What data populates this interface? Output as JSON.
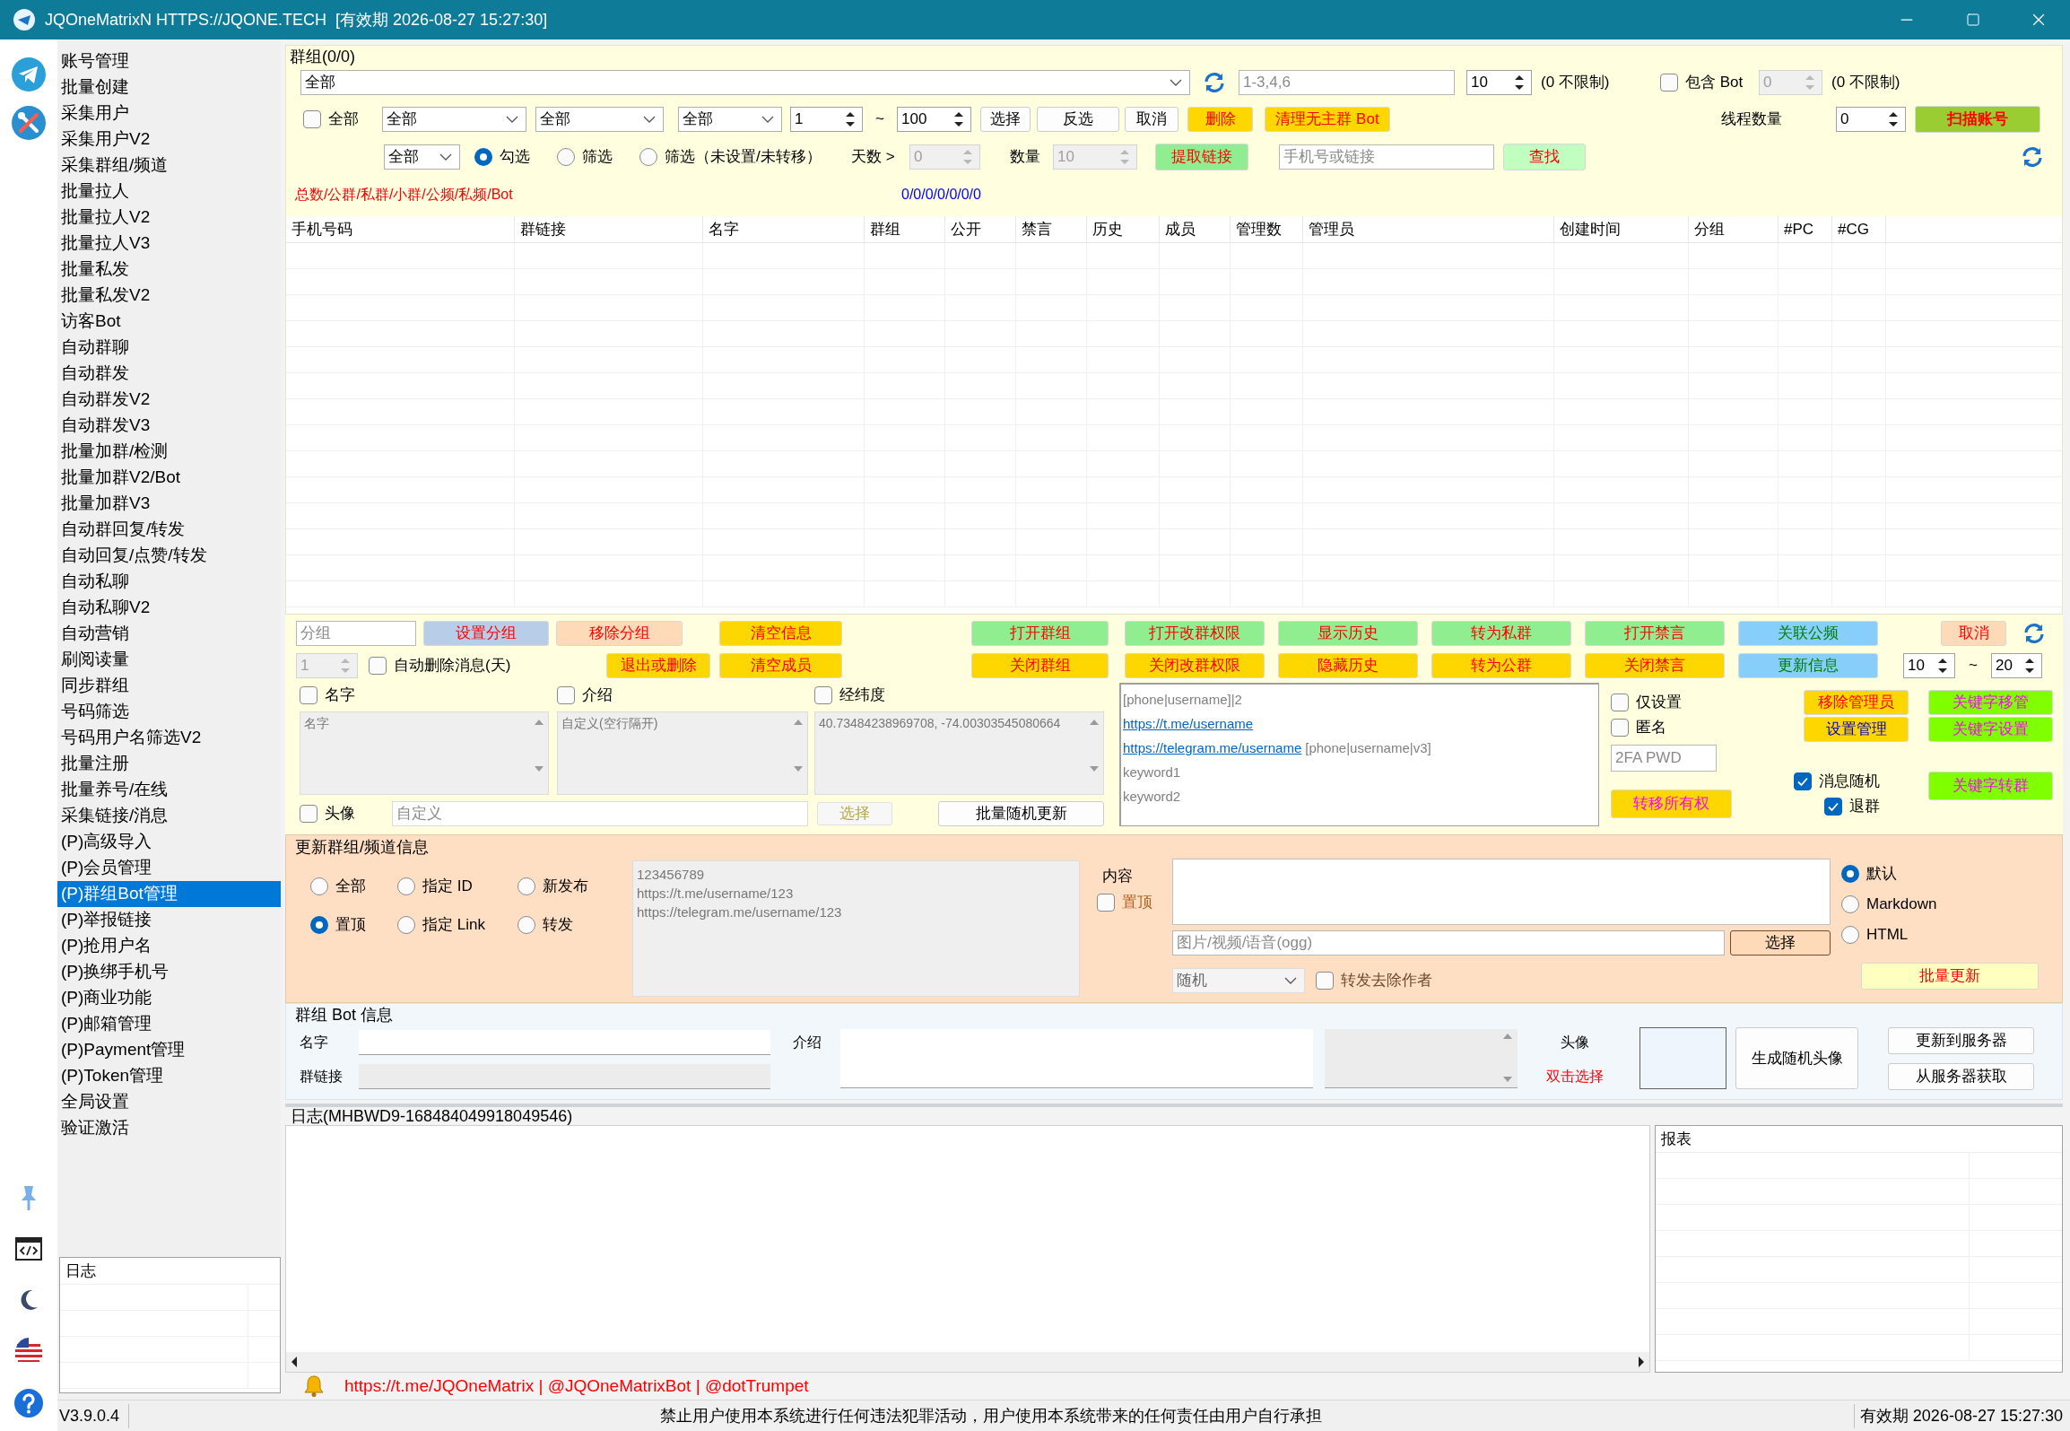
{
  "window": {
    "title": "JQOneMatrixN HTTPS://JQONE.TECH  [有效期 2026-08-27 15:27:30]"
  },
  "sidebar": {
    "items": [
      {
        "label": "账号管理",
        "selected": false
      },
      {
        "label": "批量创建",
        "selected": false
      },
      {
        "label": "采集用户",
        "selected": false
      },
      {
        "label": "采集用户V2",
        "selected": false
      },
      {
        "label": "采集群组/频道",
        "selected": false
      },
      {
        "label": "批量拉人",
        "selected": false
      },
      {
        "label": "批量拉人V2",
        "selected": false
      },
      {
        "label": "批量拉人V3",
        "selected": false
      },
      {
        "label": "批量私发",
        "selected": false
      },
      {
        "label": "批量私发V2",
        "selected": false
      },
      {
        "label": "访客Bot",
        "selected": false
      },
      {
        "label": "自动群聊",
        "selected": false
      },
      {
        "label": "自动群发",
        "selected": false
      },
      {
        "label": "自动群发V2",
        "selected": false
      },
      {
        "label": "自动群发V3",
        "selected": false
      },
      {
        "label": "批量加群/检测",
        "selected": false
      },
      {
        "label": "批量加群V2/Bot",
        "selected": false
      },
      {
        "label": "批量加群V3",
        "selected": false
      },
      {
        "label": "自动群回复/转发",
        "selected": false
      },
      {
        "label": "自动回复/点赞/转发",
        "selected": false
      },
      {
        "label": "自动私聊",
        "selected": false
      },
      {
        "label": "自动私聊V2",
        "selected": false
      },
      {
        "label": "自动营销",
        "selected": false
      },
      {
        "label": "刷阅读量",
        "selected": false
      },
      {
        "label": "同步群组",
        "selected": false
      },
      {
        "label": "号码筛选",
        "selected": false
      },
      {
        "label": "号码用户名筛选V2",
        "selected": false
      },
      {
        "label": "批量注册",
        "selected": false
      },
      {
        "label": "批量养号/在线",
        "selected": false
      },
      {
        "label": "采集链接/消息",
        "selected": false
      },
      {
        "label": "(P)高级导入",
        "selected": false
      },
      {
        "label": "(P)会员管理",
        "selected": false
      },
      {
        "label": "(P)群组Bot管理",
        "selected": true
      },
      {
        "label": "(P)举报链接",
        "selected": false
      },
      {
        "label": "(P)抢用户名",
        "selected": false
      },
      {
        "label": "(P)换绑手机号",
        "selected": false
      },
      {
        "label": "(P)商业功能",
        "selected": false
      },
      {
        "label": "(P)邮箱管理",
        "selected": false
      },
      {
        "label": "(P)Payment管理",
        "selected": false
      },
      {
        "label": "(P)Token管理",
        "selected": false
      },
      {
        "label": "全局设置",
        "selected": false
      },
      {
        "label": "验证激活",
        "selected": false
      }
    ],
    "log_title": "日志"
  },
  "groups": {
    "title": "群组(0/0)",
    "account": {
      "value": "全部"
    },
    "range": {
      "placeholder": "1-3,4,6"
    },
    "limit": {
      "value": "10",
      "disabled": false
    },
    "limit_note": "(0 不限制)",
    "include_bot": {
      "label": "包含 Bot",
      "checked": false
    },
    "bot_limit": {
      "value": "0",
      "disabled": true
    },
    "bot_note": "(0 不限制)",
    "select_all": {
      "label": "全部",
      "checked": false
    },
    "filters": [
      {
        "value": "全部"
      },
      {
        "value": "全部"
      },
      {
        "value": "全部"
      }
    ],
    "from": {
      "value": "1",
      "disabled": false
    },
    "tilde": "~",
    "to": {
      "value": "100",
      "disabled": false
    },
    "row_buttons": [
      {
        "label": "选择",
        "kind": "plain"
      },
      {
        "label": "反选",
        "kind": "plain"
      },
      {
        "label": "取消",
        "kind": "plain"
      },
      {
        "label": "删除",
        "kind": "warn"
      },
      {
        "label": "清理无主群 Bot",
        "kind": "warn"
      }
    ],
    "threads_label": "线程数量",
    "threads": {
      "value": "0",
      "disabled": false
    },
    "scan_button": {
      "label": "扫描账号",
      "kind": "scan"
    },
    "mode_filter": {
      "value": "全部"
    },
    "modes": [
      {
        "label": "勾选",
        "selected": true
      },
      {
        "label": "筛选",
        "selected": false
      },
      {
        "label": "筛选（未设置/未转移）",
        "selected": false
      }
    ],
    "days_label": "天数 >",
    "days": {
      "value": "0",
      "disabled": true
    },
    "count_label": "数量",
    "count": {
      "value": "10",
      "disabled": true
    },
    "extract_button": {
      "label": "提取链接",
      "kind": "go"
    },
    "search": {
      "placeholder": "手机号或链接"
    },
    "find_button": {
      "label": "查找",
      "kind": "find"
    },
    "stats_label": "总数/公群/私群/小群/公频/私频/Bot",
    "stats_value": "0/0/0/0/0/0/0",
    "table": {
      "columns": [
        "手机号码",
        "群链接",
        "名字",
        "群组",
        "公开",
        "禁言",
        "历史",
        "成员",
        "管理数",
        "管理员",
        "创建时间",
        "分组",
        "#PC",
        "#CG"
      ]
    }
  },
  "actions": {
    "group_field": {
      "placeholder": "分组"
    },
    "top_buttons": [
      {
        "label": "设置分组",
        "kind": "group"
      },
      {
        "label": "移除分组",
        "kind": "soft"
      },
      {
        "label": "清空信息",
        "kind": "warn"
      },
      {
        "label": "打开群组",
        "kind": "go"
      },
      {
        "label": "打开改群权限",
        "kind": "go"
      },
      {
        "label": "显示历史",
        "kind": "go"
      },
      {
        "label": "转为私群",
        "kind": "go"
      },
      {
        "label": "打开禁言",
        "kind": "go"
      },
      {
        "label": "关联公频",
        "kind": "info"
      }
    ],
    "cancel_button": {
      "label": "取消",
      "kind": "soft"
    },
    "auto_delete_days": {
      "value": "1",
      "disabled": true
    },
    "auto_delete": {
      "label": "自动删除消息(天)",
      "checked": false
    },
    "bottom_buttons": [
      {
        "label": "退出或删除",
        "kind": "warn"
      },
      {
        "label": "清空成员",
        "kind": "warn"
      },
      {
        "label": "关闭群组",
        "kind": "warn"
      },
      {
        "label": "关闭改群权限",
        "kind": "warn"
      },
      {
        "label": "隐藏历史",
        "kind": "warn"
      },
      {
        "label": "转为公群",
        "kind": "warn"
      },
      {
        "label": "关闭禁言",
        "kind": "warn"
      },
      {
        "label": "更新信息",
        "kind": "info"
      }
    ],
    "range_from": {
      "value": "10",
      "disabled": false
    },
    "tilde": "~",
    "range_to": {
      "value": "20",
      "disabled": false
    },
    "fields": [
      {
        "label": "名字",
        "checked": false,
        "placeholder": "名字"
      },
      {
        "label": "介绍",
        "checked": false,
        "placeholder": "自定义(空行隔开)"
      },
      {
        "label": "经纬度",
        "checked": false,
        "value": "40.73484238969708, -74.00303545080664"
      }
    ],
    "avatar": {
      "label": "头像",
      "checked": false
    },
    "avatar_field": {
      "placeholder": "自定义"
    },
    "avatar_pick": {
      "label": "选择",
      "kind": "disabled"
    },
    "random_update": {
      "label": "批量随机更新",
      "kind": "plain"
    },
    "template_lines": [
      [
        {
          "text": "[phone|username]|2",
          "kind": "text"
        }
      ],
      [
        {
          "text": "https://t.me/username",
          "kind": "link"
        }
      ],
      [
        {
          "text": "https://telegram.me/username",
          "kind": "link"
        },
        {
          "text": "[phone|username|v3]",
          "kind": "text"
        }
      ],
      [
        {
          "text": "keyword1",
          "kind": "text"
        }
      ],
      [
        {
          "text": "keyword2",
          "kind": "text"
        }
      ]
    ],
    "only_set": {
      "label": "仅设置",
      "checked": false
    },
    "anonymous": {
      "label": "匿名",
      "checked": false
    },
    "password": {
      "placeholder": "2FA PWD"
    },
    "transfer_owner": {
      "label": "转移所有权",
      "kind": "owner"
    },
    "remove_admin": {
      "label": "移除管理员",
      "kind": "warn"
    },
    "set_admin": {
      "label": "设置管理",
      "kind": "admin"
    },
    "random_message": {
      "label": "消息随机",
      "checked": true
    },
    "leave_group": {
      "label": "退群",
      "checked": true
    },
    "keyword_buttons": [
      {
        "label": "关键字移管",
        "kind": "keyword"
      },
      {
        "label": "关键字设置",
        "kind": "keyword"
      },
      {
        "label": "关键字转群",
        "kind": "keyword"
      }
    ]
  },
  "update": {
    "title": "更新群组/频道信息",
    "targets": [
      {
        "label": "全部",
        "selected": false
      },
      {
        "label": "指定 ID",
        "selected": false
      },
      {
        "label": "新发布",
        "selected": false
      },
      {
        "label": "置顶",
        "selected": true
      },
      {
        "label": "指定 Link",
        "selected": false
      },
      {
        "label": "转发",
        "selected": false
      }
    ],
    "ids_lines": [
      "123456789",
      "https://t.me/username/123",
      "https://telegram.me/username/123"
    ],
    "content_label": "内容",
    "pin": {
      "label": "置顶",
      "checked": false
    },
    "media": {
      "placeholder": "图片/视频/语音(ogg)"
    },
    "media_pick": {
      "label": "选择",
      "kind": "pick"
    },
    "order": {
      "value": "随机",
      "disabled": true
    },
    "strip_author": {
      "label": "转发去除作者",
      "checked": false
    },
    "formats": [
      {
        "label": "默认",
        "selected": true
      },
      {
        "label": "Markdown",
        "selected": false
      },
      {
        "label": "HTML",
        "selected": false
      }
    ],
    "batch_button": {
      "label": "批量更新",
      "kind": "batch"
    }
  },
  "bot": {
    "title": "群组 Bot 信息",
    "name_label": "名字",
    "link_label": "群链接",
    "about_label": "介绍",
    "avatar_label": "头像",
    "avatar_hint": "双击选择",
    "generate_button": {
      "label": "生成随机头像",
      "kind": "plain"
    },
    "upload_button": {
      "label": "更新到服务器",
      "kind": "plain"
    },
    "fetch_button": {
      "label": "从服务器获取",
      "kind": "plain"
    }
  },
  "log": {
    "title": "日志(MHBWD9-168484049918049546)",
    "report_title": "报表"
  },
  "footer": {
    "links": "https://t.me/JQOneMatrix | @JQOneMatrixBot | @dotTrumpet"
  },
  "status_bar": {
    "version": "V3.9.0.4",
    "notice": "禁止用户使用本系统进行任何违法犯罪活动，用户使用本系统带来的任何责任由用户自行承担",
    "expiry": "有效期 2026-08-27 15:27:30"
  }
}
